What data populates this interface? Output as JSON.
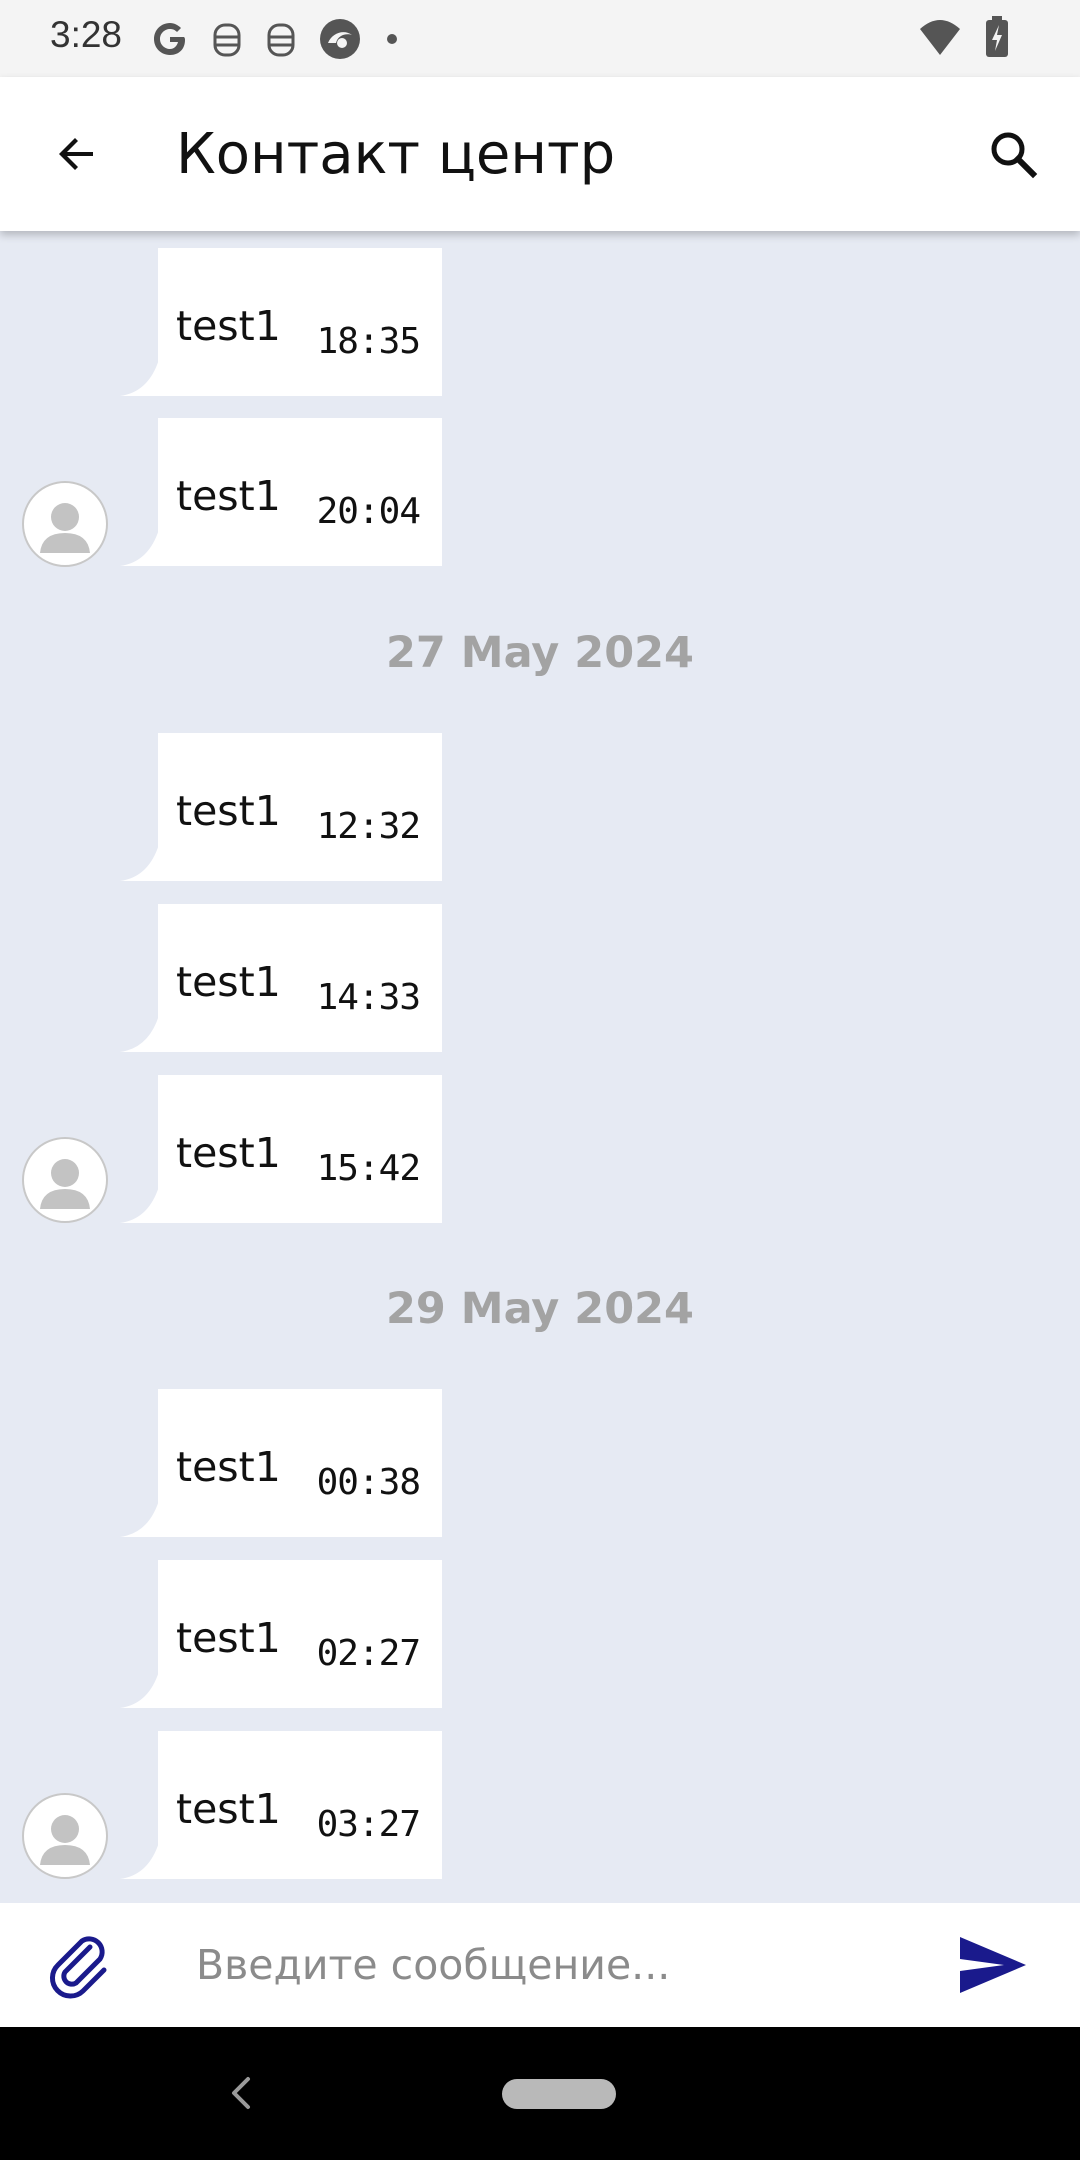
{
  "status_bar": {
    "time": "3:28",
    "left_icons": [
      "google-icon",
      "robot-icon",
      "robot-icon",
      "browser-icon",
      "dot-icon"
    ],
    "right_icons": [
      "wifi-icon",
      "battery-charging-icon"
    ]
  },
  "app_bar": {
    "title": "Контакт центр",
    "back_icon": "arrow-left-icon",
    "search_icon": "search-icon"
  },
  "messages": [
    {
      "text": "test1",
      "time": "18:35",
      "avatar": false
    },
    {
      "text": "test1",
      "time": "20:04",
      "avatar": true
    },
    {
      "date": "27 May 2024"
    },
    {
      "text": "test1",
      "time": "12:32",
      "avatar": false
    },
    {
      "text": "test1",
      "time": "14:33",
      "avatar": false
    },
    {
      "text": "test1",
      "time": "15:42",
      "avatar": true
    },
    {
      "date": "29 May 2024"
    },
    {
      "text": "test1",
      "time": "00:38",
      "avatar": false
    },
    {
      "text": "test1",
      "time": "02:27",
      "avatar": false
    },
    {
      "text": "test1",
      "time": "03:27",
      "avatar": true
    }
  ],
  "composer": {
    "placeholder": "Введите сообщение...",
    "value": "",
    "attach_icon": "paperclip-icon",
    "send_icon": "send-icon"
  },
  "colors": {
    "chat_background": "#e6eaf3",
    "bubble": "#ffffff",
    "accent": "#1a1a8c",
    "date_text": "#a3a3a3"
  }
}
